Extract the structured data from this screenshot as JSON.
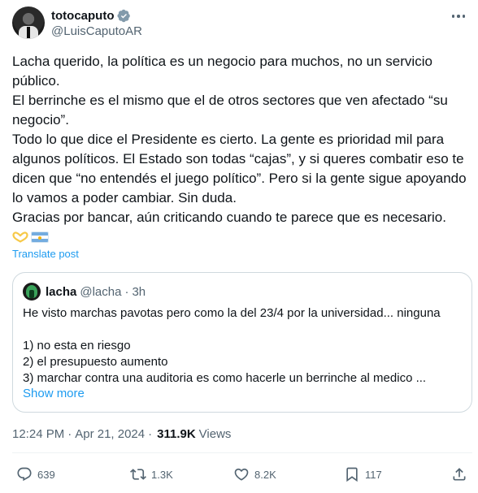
{
  "author": {
    "display_name": "totocaputo",
    "handle": "@LuisCaputoAR",
    "verified": true
  },
  "tweet": {
    "paragraphs": [
      "Lacha querido, la política es un negocio para muchos, no un servicio público.",
      "El berrinche es el mismo que el de otros sectores que ven afectado “su negocio”.",
      "Todo lo que dice el Presidente es cierto. La gente es prioridad mil para algunos políticos. El Estado son todas “cajas”, y si queres combatir eso te dicen que “no entendés el juego político”. Pero si la gente sigue apoyando lo vamos a poder cambiar. Sin duda.",
      "Gracias por bancar, aún criticando cuando te parece que es necesario."
    ],
    "emojis": [
      "heart-hands-emoji",
      "argentina-flag-emoji"
    ],
    "translate_label": "Translate post"
  },
  "quote": {
    "name": "lacha",
    "handle": "@lacha",
    "separator": "·",
    "time": "3h",
    "lines": [
      "He visto marchas pavotas pero como la del 23/4 por la universidad... ninguna",
      "",
      "1) no esta en riesgo",
      "2) el presupuesto aumento",
      "3) marchar contra una auditoria es como hacerle un berrinche al medico ..."
    ],
    "show_more_label": "Show more"
  },
  "meta": {
    "time": "12:24 PM",
    "separator": "·",
    "date": "Apr 21, 2024",
    "separator2": "·",
    "views_count": "311.9K",
    "views_label": "Views"
  },
  "actions": {
    "replies": "639",
    "reposts": "1.3K",
    "likes": "8.2K",
    "bookmarks": "117"
  },
  "colors": {
    "accent": "#1d9bf0",
    "text": "#0f1419",
    "secondary": "#536471",
    "border": "#cfd9de"
  }
}
